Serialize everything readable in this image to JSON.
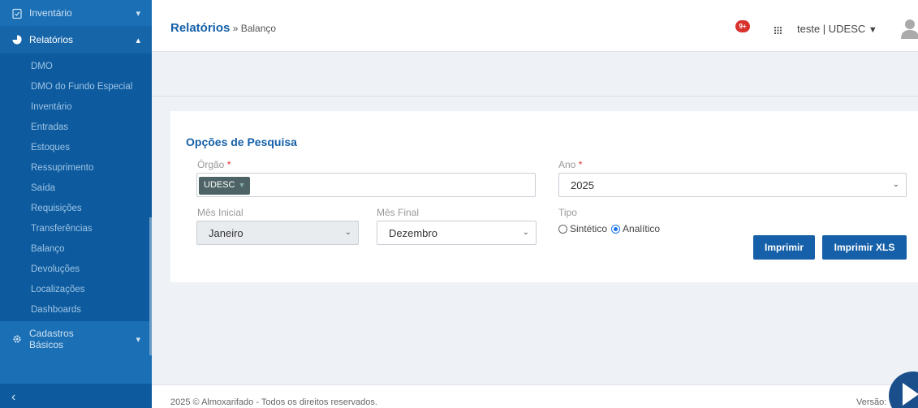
{
  "sidebar": {
    "inventario": "Inventário",
    "relatorios": "Relatórios",
    "items": [
      "DMO",
      "DMO do Fundo Especial",
      "Inventário",
      "Entradas",
      "Estoques",
      "Ressuprimento",
      "Saída",
      "Requisições",
      "Transferências",
      "Balanço",
      "Devoluções",
      "Localizações",
      "Dashboards"
    ],
    "cadastros_line1": "Cadastros",
    "cadastros_line2": "Básicos",
    "collapse": "‹"
  },
  "header": {
    "title": "Relatórios",
    "separator": " » ",
    "subtitle": "Balanço",
    "notif_count": "9+",
    "user": "teste | UDESC"
  },
  "form": {
    "title": "Opções de Pesquisa",
    "orgao_label": "Órgão",
    "orgao_tag": "UDESC",
    "ano_label": "Ano",
    "ano_value": "2025",
    "mes_inicial_label": "Mês Inicial",
    "mes_inicial_value": "Janeiro",
    "mes_final_label": "Mês Final",
    "mes_final_value": "Dezembro",
    "tipo_label": "Tipo",
    "tipo_sintetico": "Sintético",
    "tipo_analitico": "Analítico",
    "tipo_selected": "Analítico",
    "required_mark": "*"
  },
  "buttons": {
    "imprimir": "Imprimir",
    "imprimir_xls": "Imprimir XLS"
  },
  "footer": {
    "copyright": "2025 © Almoxarifado - Todos os direitos reservados.",
    "version": "Versão:"
  },
  "colors": {
    "sidebar": "#1a6fb5",
    "accent": "#1560a8",
    "badge": "#d9322c"
  }
}
